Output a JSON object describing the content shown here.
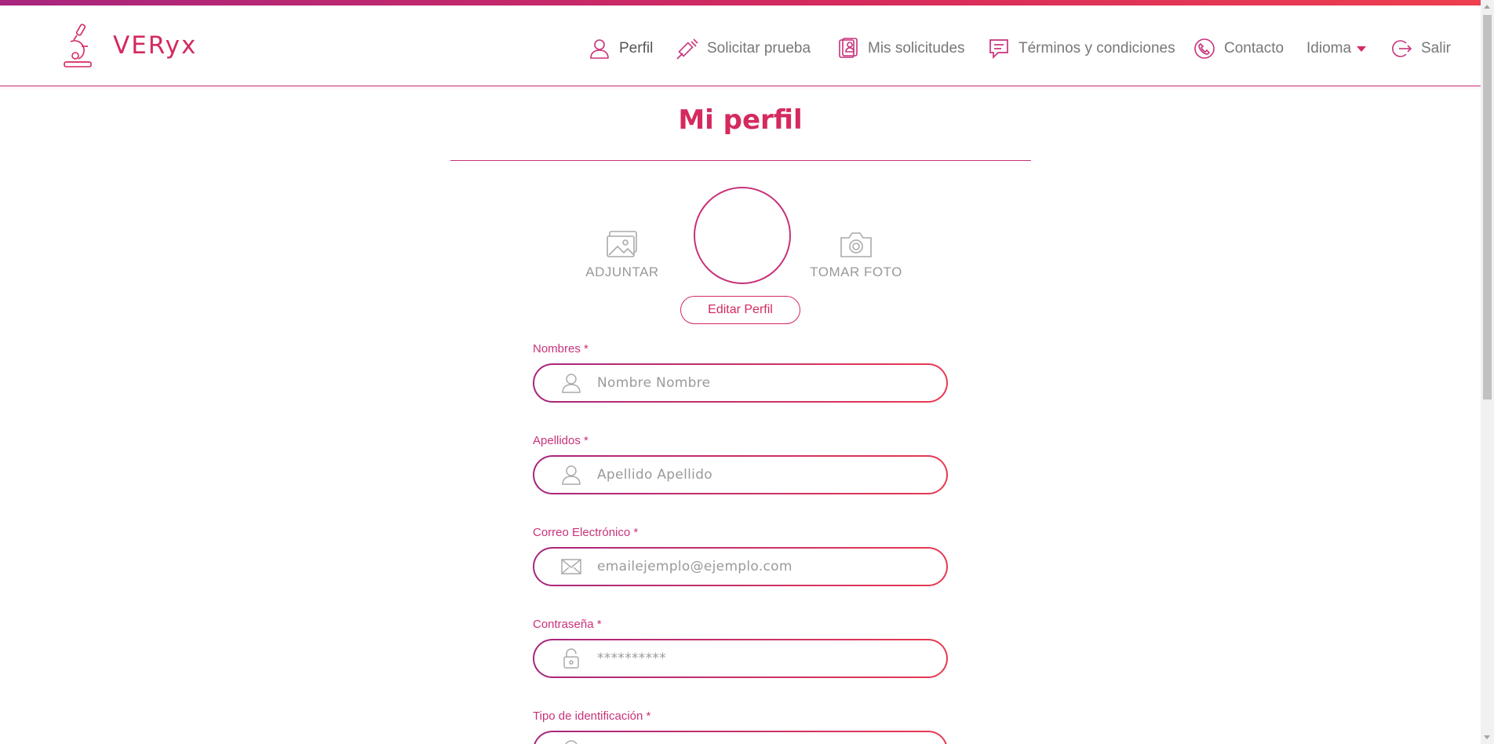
{
  "app": {
    "brand_name": "VERyx"
  },
  "nav": {
    "perfil": "Perfil",
    "solicitar": "Solicitar prueba",
    "mis_solicitudes": "Mis solicitudes",
    "terminos": "Términos y condiciones",
    "contacto": "Contacto",
    "idioma": "Idioma",
    "salir": "Salir"
  },
  "page": {
    "title": "Mi perfil"
  },
  "photo": {
    "attach_label": "ADJUNTAR",
    "take_label": "TOMAR FOTO",
    "edit_button": "Editar Perfil"
  },
  "form": {
    "nombres": {
      "label": "Nombres *",
      "placeholder": "Nombre Nombre",
      "icon": "user-icon"
    },
    "apellidos": {
      "label": "Apellidos *",
      "placeholder": "Apellido Apellido",
      "icon": "user-icon"
    },
    "correo": {
      "label": "Correo Electrónico *",
      "placeholder": "emailejemplo@ejemplo.com",
      "icon": "envelope-icon"
    },
    "contrasena": {
      "label": "Contraseña *",
      "placeholder": "**********",
      "icon": "lock-icon"
    },
    "tipo_id": {
      "label": "Tipo de identificación *",
      "icon": "id-icon"
    }
  },
  "colors": {
    "accent": "#d42a5e",
    "accent_dark": "#a8267e",
    "accent_light": "#ee3f4f"
  }
}
